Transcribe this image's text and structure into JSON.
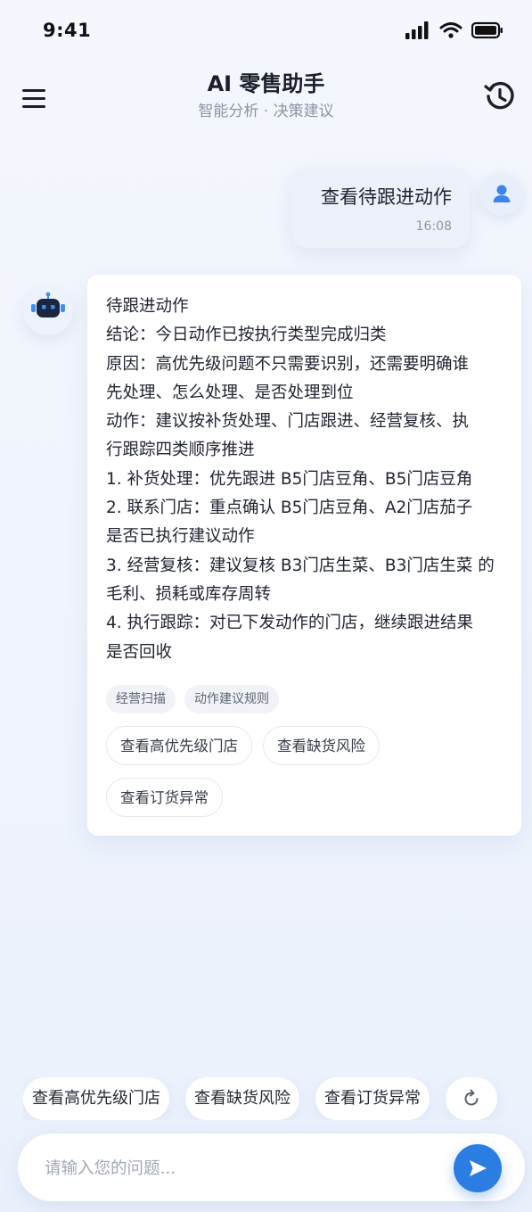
{
  "status_bar": {
    "time": "9:41",
    "icons": [
      "signal-icon",
      "wifi-icon",
      "battery-icon"
    ]
  },
  "header": {
    "title": "AI 零售助手",
    "subtitle": "智能分析 · 决策建议",
    "menu_icon": "menu-icon",
    "history_icon": "history-icon"
  },
  "user_message": {
    "text": "查看待跟进动作",
    "time": "16:08",
    "avatar_icon": "user-icon"
  },
  "bot_message": {
    "avatar_icon": "robot-icon",
    "lines": [
      "待跟进动作",
      "结论：今日动作已按执行类型完成归类",
      "原因：高优先级问题不只需要识别，还需要明确谁",
      "先处理、怎么处理、是否处理到位",
      "动作：建议按补货处理、门店跟进、经营复核、执",
      "行跟踪四类顺序推进",
      "1. 补货处理：优先跟进 B5门店豆角、B5门店豆角",
      "2. 联系门店：重点确认 B5门店豆角、A2门店茄子",
      "是否已执行建议动作",
      "3. 经营复核：建议复核 B3门店生菜、B3门店生菜 的",
      "毛利、损耗或库存周转",
      "4. 执行跟踪：对已下发动作的门店，继续跟进结果",
      "是否回收"
    ],
    "tags": [
      "经营扫描",
      "动作建议规则"
    ],
    "suggestions": [
      "查看高优先级门店",
      "查看缺货风险",
      "查看订货异常"
    ]
  },
  "quick_replies": [
    "查看高优先级门店",
    "查看缺货风险",
    "查看订货异常"
  ],
  "input": {
    "placeholder": "请输入您的问题...",
    "value": ""
  },
  "colors": {
    "accent": "#2b7de2",
    "robot_face": "#1b2740",
    "robot_eyes": "#3f8ef0",
    "user_icon": "#3b86ea"
  }
}
